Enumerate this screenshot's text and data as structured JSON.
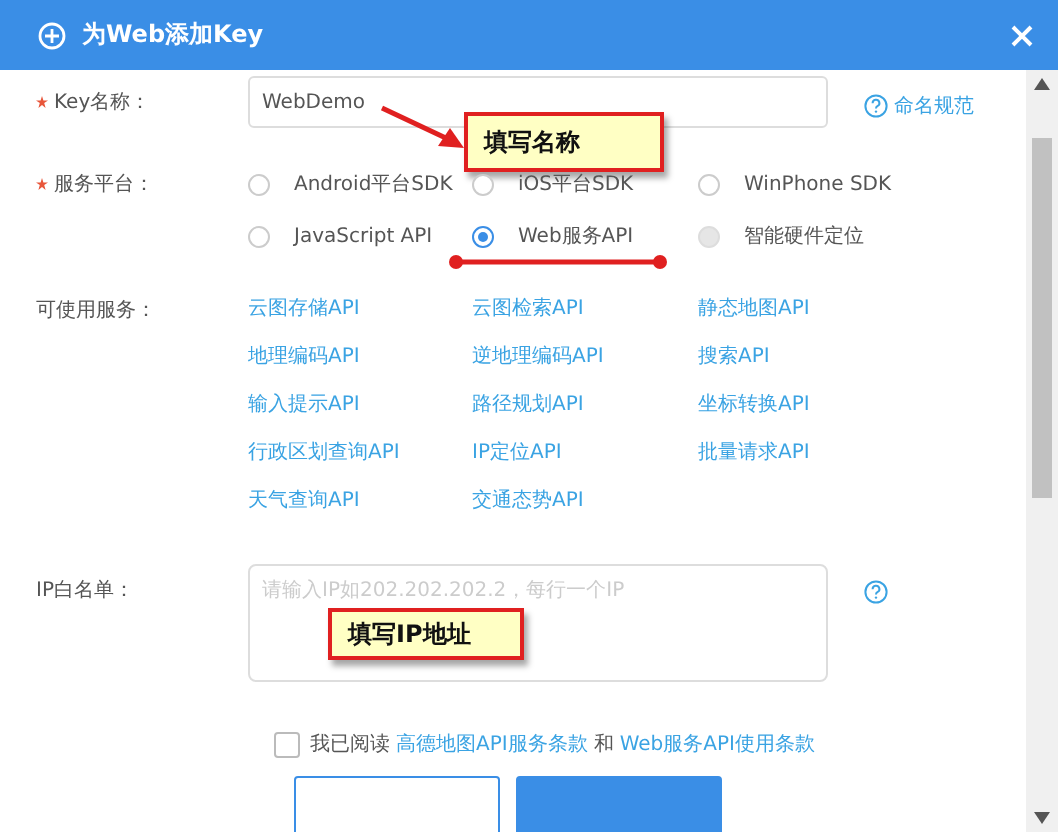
{
  "window": {
    "title": "为Web添加Key"
  },
  "key_name": {
    "label": "Key名称：",
    "required": true,
    "value": "WebDemo",
    "help_link": "命名规范",
    "callout": "填写名称"
  },
  "platform": {
    "label": "服务平台：",
    "required": true,
    "options": [
      {
        "label": "Android平台SDK",
        "selected": false,
        "disabled": false
      },
      {
        "label": "iOS平台SDK",
        "selected": false,
        "disabled": false
      },
      {
        "label": "WinPhone SDK",
        "selected": false,
        "disabled": false
      },
      {
        "label": "JavaScript API",
        "selected": false,
        "disabled": false
      },
      {
        "label": "Web服务API",
        "selected": true,
        "disabled": false
      },
      {
        "label": "智能硬件定位",
        "selected": false,
        "disabled": true
      }
    ]
  },
  "services": {
    "label": "可使用服务：",
    "items": [
      "云图存储API",
      "云图检索API",
      "静态地图API",
      "地理编码API",
      "逆地理编码API",
      "搜索API",
      "输入提示API",
      "路径规划API",
      "坐标转换API",
      "行政区划查询API",
      "IP定位API",
      "批量请求API",
      "天气查询API",
      "交通态势API"
    ]
  },
  "ip_whitelist": {
    "label": "IP白名单：",
    "placeholder": "请输入IP如202.202.202.2，每行一个IP",
    "callout": "填写IP地址"
  },
  "agreement": {
    "checked": false,
    "text": "我已阅读",
    "links": [
      "高德地图API服务条款",
      "Web服务API使用条款"
    ],
    "joiner": "和"
  },
  "buttons": [
    {
      "kind": "secondary"
    },
    {
      "kind": "primary"
    }
  ]
}
